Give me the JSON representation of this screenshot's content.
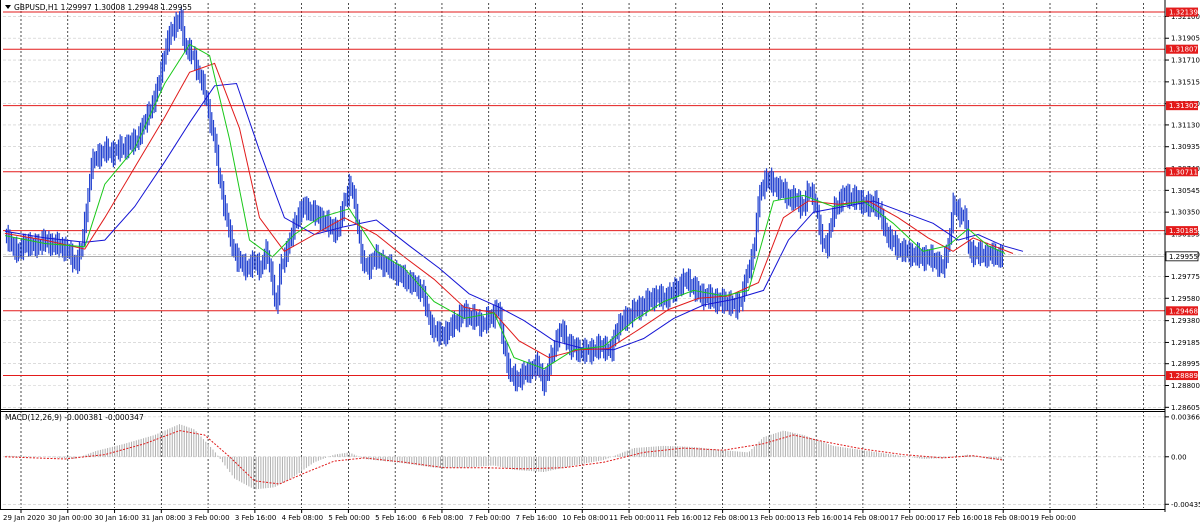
{
  "header": {
    "symbol_info": "GBPUSD,H1  1.29997 1.30008 1.29948 1.29955"
  },
  "macd_header": "MACD(12,26,9) -0.000381 -0.000347",
  "colors": {
    "candles": "#1f3fcf",
    "ma_fast": "#19c819",
    "ma_mid": "#e01b1b",
    "ma_slow": "#1414d4",
    "level_lines": "#e31b1b",
    "grid": "#c8c8c8",
    "vgrid": "#000000",
    "macd_hist": "#b0b0b0",
    "macd_signal": "#e01b1b"
  },
  "chart_data": [
    {
      "type": "candlestick",
      "title": "GBPUSD,H1",
      "y_ticks": [
        "1.32100",
        "1.31905",
        "1.31710",
        "1.31515",
        "1.31320",
        "1.31130",
        "1.30935",
        "1.30740",
        "1.30545",
        "1.30350",
        "1.30155",
        "1.29970",
        "1.29775",
        "1.29580",
        "1.29380",
        "1.29185",
        "1.28995",
        "1.28800",
        "1.28605"
      ],
      "ylim": [
        1.2859,
        1.3222
      ],
      "x_ticks": [
        "29 Jan 2020",
        "30 Jan 00:00",
        "30 Jan 16:00",
        "31 Jan 08:00",
        "3 Feb 00:00",
        "3 Feb 16:00",
        "4 Feb 08:00",
        "5 Feb 00:00",
        "5 Feb 16:00",
        "6 Feb 08:00",
        "7 Feb 00:00",
        "7 Feb 16:00",
        "10 Feb 08:00",
        "11 Feb 00:00",
        "11 Feb 16:00",
        "12 Feb 08:00",
        "13 Feb 00:00",
        "13 Feb 16:00",
        "14 Feb 08:00",
        "17 Feb 00:00",
        "17 Feb 16:00",
        "18 Feb 08:00",
        "19 Feb 00:00"
      ],
      "levels": [
        {
          "label": "1.32139",
          "value": 1.32139
        },
        {
          "label": "1.31807",
          "value": 1.31807
        },
        {
          "label": "1.31302",
          "value": 1.31302
        },
        {
          "label": "1.30711",
          "value": 1.30711
        },
        {
          "label": "1.30185",
          "value": 1.30185
        },
        {
          "label": "1.29468",
          "value": 1.29468
        },
        {
          "label": "1.28889",
          "value": 1.28889
        }
      ],
      "current_price": {
        "label": "1.29955",
        "value": 1.29955
      },
      "close_path": [
        [
          0,
          1.3013
        ],
        [
          8,
          1.3005
        ],
        [
          14,
          1.2998
        ],
        [
          20,
          1.3008
        ],
        [
          28,
          1.3004
        ],
        [
          38,
          1.3009
        ],
        [
          50,
          1.3006
        ],
        [
          62,
          1.3002
        ],
        [
          70,
          1.2989
        ],
        [
          76,
          1.2999
        ],
        [
          82,
          1.304
        ],
        [
          86,
          1.3075
        ],
        [
          92,
          1.3085
        ],
        [
          100,
          1.309
        ],
        [
          108,
          1.3088
        ],
        [
          116,
          1.3092
        ],
        [
          124,
          1.3095
        ],
        [
          132,
          1.31
        ],
        [
          138,
          1.311
        ],
        [
          144,
          1.3125
        ],
        [
          150,
          1.3135
        ],
        [
          156,
          1.316
        ],
        [
          162,
          1.3185
        ],
        [
          168,
          1.32
        ],
        [
          176,
          1.3208
        ],
        [
          180,
          1.3185
        ],
        [
          186,
          1.3178
        ],
        [
          192,
          1.3165
        ],
        [
          198,
          1.315
        ],
        [
          204,
          1.3125
        ],
        [
          210,
          1.31
        ],
        [
          214,
          1.307
        ],
        [
          220,
          1.304
        ],
        [
          226,
          1.301
        ],
        [
          232,
          1.2995
        ],
        [
          240,
          1.2985
        ],
        [
          250,
          1.299
        ],
        [
          256,
          1.2985
        ],
        [
          262,
          1.3
        ],
        [
          268,
          1.2975
        ],
        [
          272,
          1.2948
        ],
        [
          276,
          1.2985
        ],
        [
          280,
          1.2995
        ],
        [
          286,
          1.301
        ],
        [
          292,
          1.303
        ],
        [
          300,
          1.304
        ],
        [
          308,
          1.3035
        ],
        [
          316,
          1.303
        ],
        [
          326,
          1.3022
        ],
        [
          334,
          1.3018
        ],
        [
          340,
          1.3045
        ],
        [
          346,
          1.306
        ],
        [
          352,
          1.3035
        ],
        [
          358,
          1.299
        ],
        [
          364,
          1.2985
        ],
        [
          370,
          1.2995
        ],
        [
          378,
          1.299
        ],
        [
          386,
          1.2985
        ],
        [
          394,
          1.298
        ],
        [
          402,
          1.2975
        ],
        [
          410,
          1.297
        ],
        [
          418,
          1.2965
        ],
        [
          426,
          1.2935
        ],
        [
          434,
          1.2925
        ],
        [
          444,
          1.2928
        ],
        [
          452,
          1.2938
        ],
        [
          460,
          1.2945
        ],
        [
          470,
          1.294
        ],
        [
          478,
          1.2935
        ],
        [
          486,
          1.294
        ],
        [
          494,
          1.295
        ],
        [
          500,
          1.2915
        ],
        [
          506,
          1.289
        ],
        [
          512,
          1.2885
        ],
        [
          520,
          1.289
        ],
        [
          528,
          1.2895
        ],
        [
          534,
          1.2898
        ],
        [
          540,
          1.2882
        ],
        [
          546,
          1.29
        ],
        [
          552,
          1.292
        ],
        [
          558,
          1.293
        ],
        [
          566,
          1.2915
        ],
        [
          574,
          1.2912
        ],
        [
          582,
          1.291
        ],
        [
          592,
          1.2913
        ],
        [
          600,
          1.2915
        ],
        [
          608,
          1.291
        ],
        [
          612,
          1.293
        ],
        [
          620,
          1.2938
        ],
        [
          628,
          1.2945
        ],
        [
          636,
          1.295
        ],
        [
          644,
          1.2955
        ],
        [
          652,
          1.296
        ],
        [
          660,
          1.2958
        ],
        [
          668,
          1.2962
        ],
        [
          676,
          1.297
        ],
        [
          684,
          1.2975
        ],
        [
          692,
          1.2965
        ],
        [
          700,
          1.296
        ],
        [
          708,
          1.2958
        ],
        [
          716,
          1.2955
        ],
        [
          724,
          1.2955
        ],
        [
          732,
          1.295
        ],
        [
          738,
          1.2958
        ],
        [
          744,
          1.298
        ],
        [
          750,
          1.3
        ],
        [
          756,
          1.305
        ],
        [
          762,
          1.3065
        ],
        [
          770,
          1.306
        ],
        [
          778,
          1.3055
        ],
        [
          786,
          1.3048
        ],
        [
          794,
          1.3045
        ],
        [
          800,
          1.304
        ],
        [
          806,
          1.3055
        ],
        [
          812,
          1.3045
        ],
        [
          818,
          1.301
        ],
        [
          824,
          1.3005
        ],
        [
          830,
          1.3035
        ],
        [
          836,
          1.3045
        ],
        [
          842,
          1.305
        ],
        [
          850,
          1.3048
        ],
        [
          858,
          1.3045
        ],
        [
          866,
          1.304
        ],
        [
          872,
          1.3045
        ],
        [
          878,
          1.303
        ],
        [
          884,
          1.3015
        ],
        [
          892,
          1.3005
        ],
        [
          900,
          1.3
        ],
        [
          908,
          1.2998
        ],
        [
          916,
          1.2995
        ],
        [
          924,
          1.2995
        ],
        [
          932,
          1.2992
        ],
        [
          940,
          1.2985
        ],
        [
          946,
          1.301
        ],
        [
          950,
          1.304
        ],
        [
          956,
          1.3035
        ],
        [
          962,
          1.303
        ],
        [
          966,
          1.3
        ],
        [
          972,
          1.2998
        ],
        [
          980,
          1.2997
        ],
        [
          988,
          1.2997
        ],
        [
          996,
          1.2996
        ],
        [
          1000,
          1.29955
        ]
      ],
      "ma_fast_path": [
        [
          0,
          1.3014
        ],
        [
          40,
          1.3007
        ],
        [
          80,
          1.3004
        ],
        [
          100,
          1.306
        ],
        [
          130,
          1.3092
        ],
        [
          160,
          1.315
        ],
        [
          185,
          1.3185
        ],
        [
          205,
          1.3175
        ],
        [
          225,
          1.31
        ],
        [
          245,
          1.301
        ],
        [
          268,
          1.2995
        ],
        [
          290,
          1.3015
        ],
        [
          315,
          1.303
        ],
        [
          345,
          1.3038
        ],
        [
          372,
          1.3
        ],
        [
          400,
          1.2985
        ],
        [
          430,
          1.2955
        ],
        [
          460,
          1.294
        ],
        [
          490,
          1.2945
        ],
        [
          510,
          1.2905
        ],
        [
          540,
          1.2895
        ],
        [
          570,
          1.2912
        ],
        [
          600,
          1.2915
        ],
        [
          630,
          1.2938
        ],
        [
          660,
          1.2955
        ],
        [
          690,
          1.2965
        ],
        [
          720,
          1.296
        ],
        [
          745,
          1.2965
        ],
        [
          770,
          1.3045
        ],
        [
          800,
          1.305
        ],
        [
          830,
          1.304
        ],
        [
          860,
          1.3045
        ],
        [
          890,
          1.3025
        ],
        [
          920,
          1.3
        ],
        [
          945,
          1.3005
        ],
        [
          965,
          1.302
        ],
        [
          985,
          1.3005
        ],
        [
          1002,
          1.2998
        ]
      ],
      "ma_mid_path": [
        [
          0,
          1.3016
        ],
        [
          40,
          1.301
        ],
        [
          80,
          1.3002
        ],
        [
          100,
          1.303
        ],
        [
          130,
          1.3075
        ],
        [
          160,
          1.312
        ],
        [
          185,
          1.316
        ],
        [
          210,
          1.3168
        ],
        [
          235,
          1.311
        ],
        [
          255,
          1.303
        ],
        [
          280,
          1.3
        ],
        [
          310,
          1.3015
        ],
        [
          340,
          1.303
        ],
        [
          372,
          1.3015
        ],
        [
          400,
          1.2995
        ],
        [
          430,
          1.2975
        ],
        [
          460,
          1.295
        ],
        [
          490,
          1.2945
        ],
        [
          515,
          1.292
        ],
        [
          545,
          1.2905
        ],
        [
          575,
          1.2912
        ],
        [
          605,
          1.2913
        ],
        [
          635,
          1.293
        ],
        [
          665,
          1.2948
        ],
        [
          695,
          1.2958
        ],
        [
          725,
          1.296
        ],
        [
          755,
          1.2972
        ],
        [
          780,
          1.303
        ],
        [
          805,
          1.3045
        ],
        [
          835,
          1.3042
        ],
        [
          865,
          1.3045
        ],
        [
          895,
          1.303
        ],
        [
          925,
          1.3012
        ],
        [
          950,
          1.3
        ],
        [
          970,
          1.3012
        ],
        [
          990,
          1.3005
        ],
        [
          1010,
          1.2998
        ]
      ],
      "ma_slow_path": [
        [
          0,
          1.3018
        ],
        [
          40,
          1.3012
        ],
        [
          80,
          1.3008
        ],
        [
          100,
          1.301
        ],
        [
          130,
          1.304
        ],
        [
          160,
          1.308
        ],
        [
          185,
          1.3115
        ],
        [
          210,
          1.3148
        ],
        [
          232,
          1.315
        ],
        [
          255,
          1.309
        ],
        [
          280,
          1.303
        ],
        [
          310,
          1.3015
        ],
        [
          340,
          1.3022
        ],
        [
          372,
          1.3028
        ],
        [
          405,
          1.3005
        ],
        [
          435,
          1.2985
        ],
        [
          465,
          1.2962
        ],
        [
          495,
          1.295
        ],
        [
          520,
          1.2938
        ],
        [
          550,
          1.292
        ],
        [
          580,
          1.2913
        ],
        [
          610,
          1.2912
        ],
        [
          640,
          1.2922
        ],
        [
          670,
          1.294
        ],
        [
          700,
          1.2952
        ],
        [
          730,
          1.2957
        ],
        [
          760,
          1.2965
        ],
        [
          785,
          1.301
        ],
        [
          810,
          1.3035
        ],
        [
          840,
          1.304
        ],
        [
          870,
          1.3045
        ],
        [
          900,
          1.3035
        ],
        [
          930,
          1.3025
        ],
        [
          955,
          1.301
        ],
        [
          975,
          1.3015
        ],
        [
          1000,
          1.3005
        ],
        [
          1020,
          1.3
        ]
      ]
    },
    {
      "type": "bar",
      "title": "MACD(12,26,9) -0.000381 -0.000347",
      "y_ticks": [
        "0.003662",
        "0.00",
        "-0.004358"
      ],
      "ylim": [
        -0.0047,
        0.0042
      ],
      "hist_path": [
        [
          0,
          0.0001
        ],
        [
          40,
          0.0
        ],
        [
          70,
          -0.0002
        ],
        [
          90,
          0.0005
        ],
        [
          120,
          0.0012
        ],
        [
          150,
          0.002
        ],
        [
          175,
          0.003
        ],
        [
          190,
          0.0025
        ],
        [
          210,
          0.0005
        ],
        [
          230,
          -0.002
        ],
        [
          250,
          -0.003
        ],
        [
          270,
          -0.0028
        ],
        [
          290,
          -0.0018
        ],
        [
          310,
          -0.0005
        ],
        [
          330,
          0.0002
        ],
        [
          345,
          0.0004
        ],
        [
          360,
          -0.0002
        ],
        [
          400,
          -0.0006
        ],
        [
          430,
          -0.001
        ],
        [
          460,
          -0.001
        ],
        [
          490,
          -0.0008
        ],
        [
          510,
          -0.0012
        ],
        [
          540,
          -0.0014
        ],
        [
          570,
          -0.0008
        ],
        [
          600,
          -0.0003
        ],
        [
          630,
          0.0008
        ],
        [
          660,
          0.001
        ],
        [
          690,
          0.0009
        ],
        [
          720,
          0.0006
        ],
        [
          745,
          0.0004
        ],
        [
          760,
          0.0018
        ],
        [
          780,
          0.0024
        ],
        [
          800,
          0.002
        ],
        [
          830,
          0.001
        ],
        [
          860,
          0.0006
        ],
        [
          890,
          0.0002
        ],
        [
          920,
          -0.0002
        ],
        [
          945,
          -0.0001
        ],
        [
          965,
          0.0002
        ],
        [
          985,
          -0.0002
        ],
        [
          1000,
          -0.0003
        ]
      ],
      "signal_path": [
        [
          0,
          0.0
        ],
        [
          60,
          -0.0002
        ],
        [
          100,
          0.0002
        ],
        [
          140,
          0.0012
        ],
        [
          175,
          0.0024
        ],
        [
          200,
          0.002
        ],
        [
          225,
          0.0
        ],
        [
          250,
          -0.0022
        ],
        [
          275,
          -0.0025
        ],
        [
          300,
          -0.0015
        ],
        [
          330,
          -0.0004
        ],
        [
          360,
          -0.0001
        ],
        [
          400,
          -0.0005
        ],
        [
          440,
          -0.001
        ],
        [
          480,
          -0.001
        ],
        [
          520,
          -0.0011
        ],
        [
          560,
          -0.001
        ],
        [
          600,
          -0.0005
        ],
        [
          640,
          0.0004
        ],
        [
          680,
          0.0008
        ],
        [
          720,
          0.0006
        ],
        [
          760,
          0.0012
        ],
        [
          790,
          0.002
        ],
        [
          820,
          0.0014
        ],
        [
          860,
          0.0007
        ],
        [
          900,
          0.0002
        ],
        [
          940,
          -0.0001
        ],
        [
          970,
          0.0001
        ],
        [
          1000,
          -0.0003
        ]
      ]
    }
  ]
}
